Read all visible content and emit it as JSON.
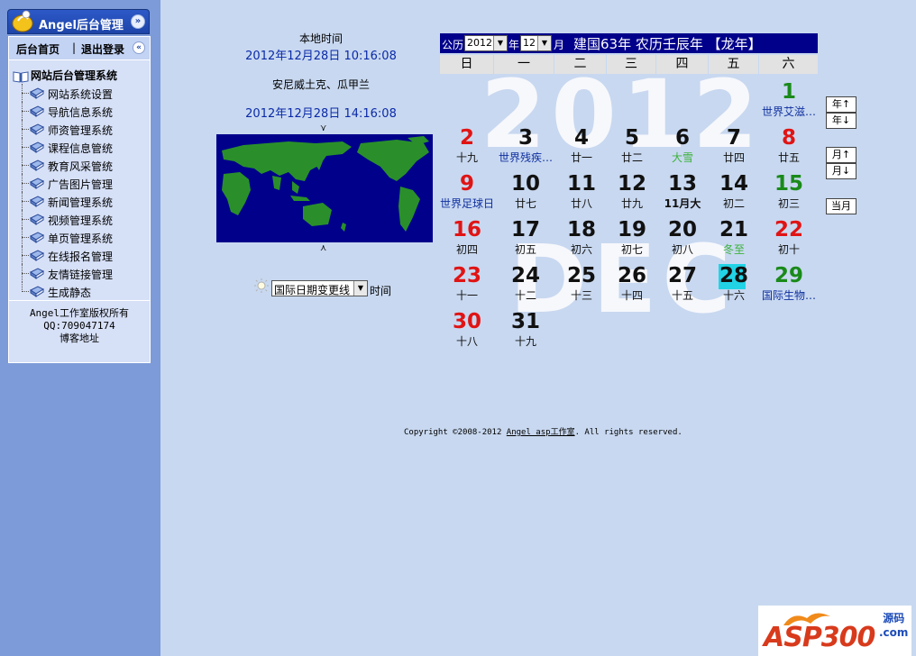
{
  "sidebar": {
    "title": "Angel后台管理",
    "nav_home": "后台首页",
    "nav_sep": "|",
    "nav_logout": "退出登录",
    "tree_root": "网站后台管理系统",
    "items": [
      {
        "label": "网站系统设置"
      },
      {
        "label": "导航信息系统"
      },
      {
        "label": "师资管理系统"
      },
      {
        "label": "课程信息管统"
      },
      {
        "label": "教育风采管统"
      },
      {
        "label": "广告图片管理"
      },
      {
        "label": "新闻管理系统"
      },
      {
        "label": "视频管理系统"
      },
      {
        "label": "单页管理系统"
      },
      {
        "label": "在线报名管理"
      },
      {
        "label": "友情链接管理"
      },
      {
        "label": "生成静态"
      }
    ],
    "footer": {
      "copyright": "Angel工作室版权所有",
      "qq": "QQ:709047174",
      "blog": "博客地址"
    }
  },
  "clock": {
    "local_label": "本地时间",
    "local_time": "2012年12月28日  10:16:08",
    "city_label": "安尼威土克、瓜甲兰",
    "city_time": "2012年12月28日  14:16:08",
    "marker_top": "⋎",
    "marker_bottom": "⋏",
    "timezone_value": "国际日期变更线",
    "timezone_suffix": "时间"
  },
  "calendar": {
    "year_prefix": "公历",
    "year_value": "2012",
    "year_suffix": "年",
    "month_value": "12",
    "month_suffix": "月",
    "lunar_info": "建国63年  农历壬辰年  【龙年】",
    "bg_year": "2012",
    "bg_month": "DEC",
    "weekdays": [
      "日",
      "一",
      "二",
      "三",
      "四",
      "五",
      "六"
    ],
    "colors": {
      "red": "#e01414",
      "black": "#111111",
      "green": "#1a8a1a",
      "blue": "#1030a0",
      "light_green": "#3cb23c",
      "today": "#22d3e6"
    },
    "days": [
      {
        "num": "1",
        "sub": "世界艾滋…",
        "col": 6,
        "row": 0,
        "num_color": "green",
        "sub_color": "blue"
      },
      {
        "num": "2",
        "sub": "十九",
        "col": 0,
        "row": 1,
        "num_color": "red",
        "sub_color": "black"
      },
      {
        "num": "3",
        "sub": "世界残疾…",
        "col": 1,
        "row": 1,
        "num_color": "black",
        "sub_color": "blue"
      },
      {
        "num": "4",
        "sub": "廿一",
        "col": 2,
        "row": 1,
        "num_color": "black",
        "sub_color": "black"
      },
      {
        "num": "5",
        "sub": "廿二",
        "col": 3,
        "row": 1,
        "num_color": "black",
        "sub_color": "black"
      },
      {
        "num": "6",
        "sub": "大雪",
        "col": 4,
        "row": 1,
        "num_color": "black",
        "sub_color": "light_green"
      },
      {
        "num": "7",
        "sub": "廿四",
        "col": 5,
        "row": 1,
        "num_color": "black",
        "sub_color": "black"
      },
      {
        "num": "8",
        "sub": "廿五",
        "col": 6,
        "row": 1,
        "num_color": "red",
        "sub_color": "black"
      },
      {
        "num": "9",
        "sub": "世界足球日",
        "col": 0,
        "row": 2,
        "num_color": "red",
        "sub_color": "blue"
      },
      {
        "num": "10",
        "sub": "廿七",
        "col": 1,
        "row": 2,
        "num_color": "black",
        "sub_color": "black"
      },
      {
        "num": "11",
        "sub": "廿八",
        "col": 2,
        "row": 2,
        "num_color": "black",
        "sub_color": "black"
      },
      {
        "num": "12",
        "sub": "廿九",
        "col": 3,
        "row": 2,
        "num_color": "black",
        "sub_color": "black"
      },
      {
        "num": "13",
        "sub": "11月大",
        "col": 4,
        "row": 2,
        "num_color": "black",
        "sub_color": "black",
        "sub_bold": true
      },
      {
        "num": "14",
        "sub": "初二",
        "col": 5,
        "row": 2,
        "num_color": "black",
        "sub_color": "black"
      },
      {
        "num": "15",
        "sub": "初三",
        "col": 6,
        "row": 2,
        "num_color": "green",
        "sub_color": "black"
      },
      {
        "num": "16",
        "sub": "初四",
        "col": 0,
        "row": 3,
        "num_color": "red",
        "sub_color": "black"
      },
      {
        "num": "17",
        "sub": "初五",
        "col": 1,
        "row": 3,
        "num_color": "black",
        "sub_color": "black"
      },
      {
        "num": "18",
        "sub": "初六",
        "col": 2,
        "row": 3,
        "num_color": "black",
        "sub_color": "black"
      },
      {
        "num": "19",
        "sub": "初七",
        "col": 3,
        "row": 3,
        "num_color": "black",
        "sub_color": "black"
      },
      {
        "num": "20",
        "sub": "初八",
        "col": 4,
        "row": 3,
        "num_color": "black",
        "sub_color": "black"
      },
      {
        "num": "21",
        "sub": "冬至",
        "col": 5,
        "row": 3,
        "num_color": "black",
        "sub_color": "light_green"
      },
      {
        "num": "22",
        "sub": "初十",
        "col": 6,
        "row": 3,
        "num_color": "red",
        "sub_color": "black"
      },
      {
        "num": "23",
        "sub": "十一",
        "col": 0,
        "row": 4,
        "num_color": "red",
        "sub_color": "black"
      },
      {
        "num": "24",
        "sub": "十二",
        "col": 1,
        "row": 4,
        "num_color": "black",
        "sub_color": "black"
      },
      {
        "num": "25",
        "sub": "十三",
        "col": 2,
        "row": 4,
        "num_color": "black",
        "sub_color": "black"
      },
      {
        "num": "26",
        "sub": "十四",
        "col": 3,
        "row": 4,
        "num_color": "black",
        "sub_color": "black"
      },
      {
        "num": "27",
        "sub": "十五",
        "col": 4,
        "row": 4,
        "num_color": "black",
        "sub_color": "black"
      },
      {
        "num": "28",
        "sub": "十六",
        "col": 5,
        "row": 4,
        "num_color": "black",
        "sub_color": "black",
        "today": true
      },
      {
        "num": "29",
        "sub": "国际生物…",
        "col": 6,
        "row": 4,
        "num_color": "green",
        "sub_color": "blue"
      },
      {
        "num": "30",
        "sub": "十八",
        "col": 0,
        "row": 5,
        "num_color": "red",
        "sub_color": "black"
      },
      {
        "num": "31",
        "sub": "十九",
        "col": 1,
        "row": 5,
        "num_color": "black",
        "sub_color": "black"
      }
    ],
    "buttons": {
      "year_up": "年↑",
      "year_down": "年↓",
      "month_up": "月↑",
      "month_down": "月↓",
      "this_month": "当月"
    }
  },
  "footer": {
    "copyright_pre": "Copyright ©2008-2012 ",
    "copyright_link": "Angel_asp工作室",
    "copyright_post": ". All rights reserved."
  },
  "watermark": {
    "brand": "ASP300",
    "side_top": "源码",
    "side_bottom": ".com"
  }
}
